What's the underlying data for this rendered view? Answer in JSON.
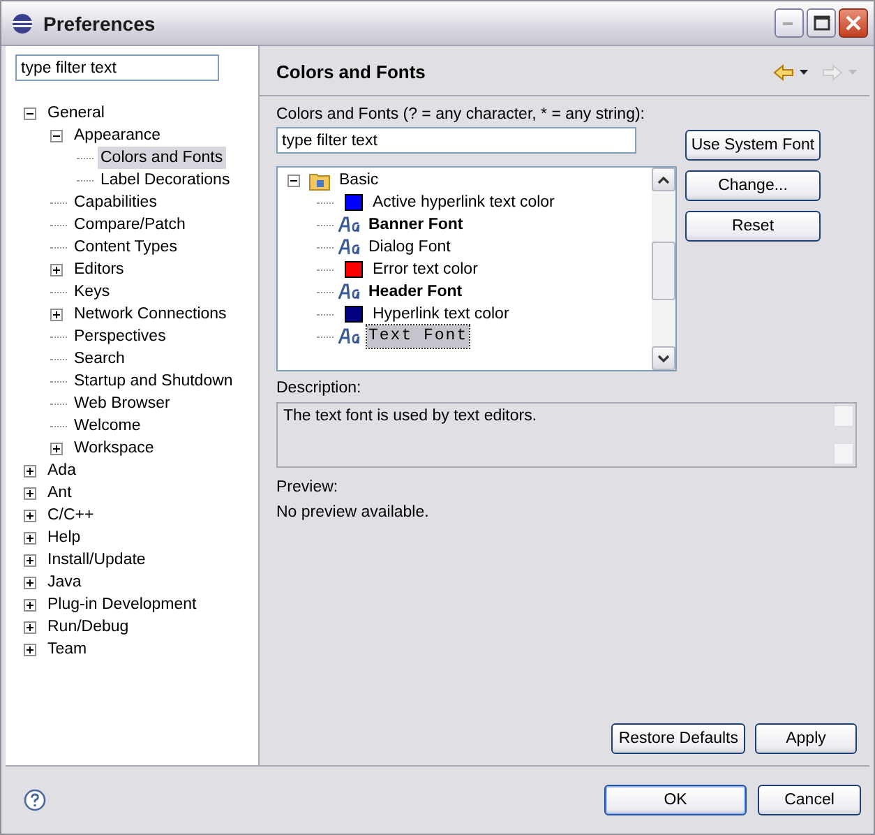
{
  "window": {
    "title": "Preferences"
  },
  "nav": {
    "filter": "type filter text",
    "items": [
      {
        "label": "General",
        "expanded": true,
        "selected": false,
        "children": [
          {
            "label": "Appearance",
            "expanded": true,
            "selected": false,
            "children": [
              {
                "label": "Colors and Fonts",
                "selected": true
              },
              {
                "label": "Label Decorations",
                "selected": false
              }
            ]
          },
          {
            "label": "Capabilities",
            "selected": false
          },
          {
            "label": "Compare/Patch",
            "selected": false
          },
          {
            "label": "Content Types",
            "selected": false
          },
          {
            "label": "Editors",
            "expanded": false,
            "selected": false
          },
          {
            "label": "Keys",
            "selected": false
          },
          {
            "label": "Network Connections",
            "expanded": false,
            "selected": false
          },
          {
            "label": "Perspectives",
            "selected": false
          },
          {
            "label": "Search",
            "selected": false
          },
          {
            "label": "Startup and Shutdown",
            "selected": false
          },
          {
            "label": "Web Browser",
            "selected": false
          },
          {
            "label": "Welcome",
            "selected": false
          },
          {
            "label": "Workspace",
            "expanded": false,
            "selected": false
          }
        ]
      },
      {
        "label": "Ada",
        "expanded": false,
        "selected": false
      },
      {
        "label": "Ant",
        "expanded": false,
        "selected": false
      },
      {
        "label": "C/C++",
        "expanded": false,
        "selected": false
      },
      {
        "label": "Help",
        "expanded": false,
        "selected": false
      },
      {
        "label": "Install/Update",
        "expanded": false,
        "selected": false
      },
      {
        "label": "Java",
        "expanded": false,
        "selected": false
      },
      {
        "label": "Plug-in Development",
        "expanded": false,
        "selected": false
      },
      {
        "label": "Run/Debug",
        "expanded": false,
        "selected": false
      },
      {
        "label": "Team",
        "expanded": false,
        "selected": false
      }
    ]
  },
  "page": {
    "title": "Colors and Fonts",
    "filter_label": "Colors and Fonts (? = any character, * = any string):",
    "filter": "type filter text",
    "font_tree": [
      {
        "label": "Basic",
        "kind": "category",
        "expanded": true,
        "selected": false,
        "children": [
          {
            "label": "Active hyperlink text color",
            "kind": "color",
            "color": "#0000ff",
            "selected": false
          },
          {
            "label": "Banner Font",
            "kind": "font",
            "bold": true,
            "monospace": false,
            "selected": false
          },
          {
            "label": "Dialog Font",
            "kind": "font",
            "bold": false,
            "monospace": false,
            "selected": false
          },
          {
            "label": "Error text color",
            "kind": "color",
            "color": "#ff0000",
            "selected": false
          },
          {
            "label": "Header Font",
            "kind": "font",
            "bold": true,
            "monospace": false,
            "selected": false
          },
          {
            "label": "Hyperlink text color",
            "kind": "color",
            "color": "#000080",
            "selected": false
          },
          {
            "label": "Text Font",
            "kind": "font",
            "bold": false,
            "monospace": true,
            "selected": true
          }
        ]
      }
    ],
    "side_buttons": [
      "Use System Font",
      "Change...",
      "Reset"
    ],
    "description_label": "Description:",
    "description": "The text font is used by text editors.",
    "preview_label": "Preview:",
    "preview": "No preview available.",
    "page_buttons": [
      "Restore Defaults",
      "Apply"
    ]
  },
  "buttons": [
    "OK",
    "Cancel"
  ]
}
